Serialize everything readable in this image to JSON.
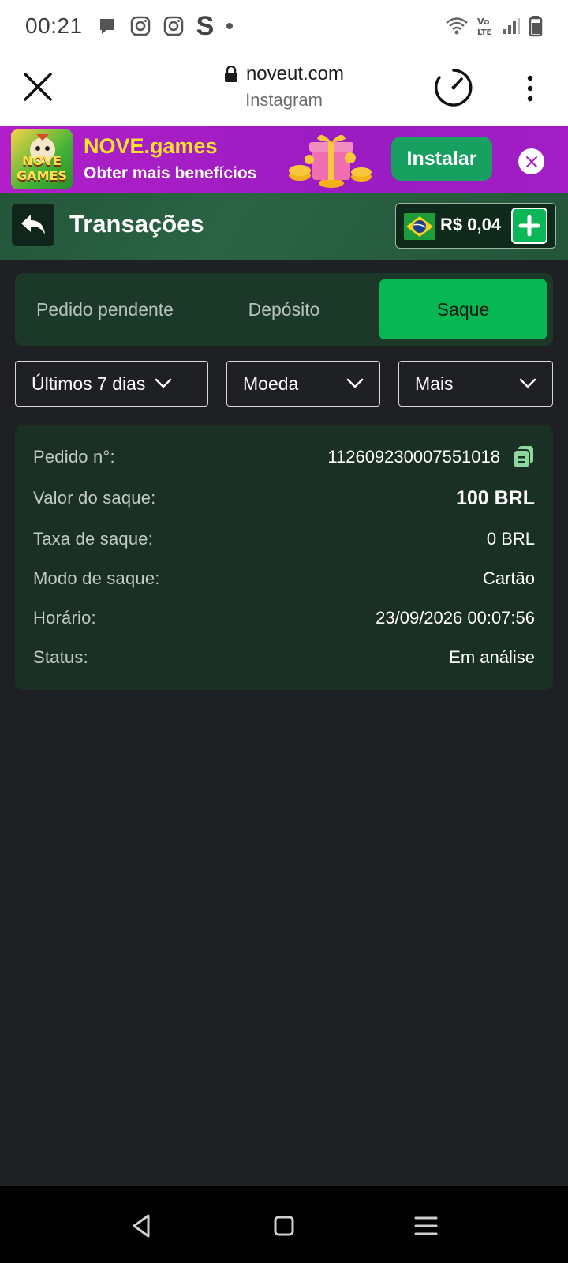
{
  "status_bar": {
    "time": "00:21",
    "icons_left": [
      "message-icon",
      "instagram-icon",
      "instagram-icon",
      "s-letter-icon"
    ],
    "s_letter": "S",
    "icons_right": [
      "wifi-icon",
      "volte-icon",
      "signal-icon",
      "battery-icon"
    ]
  },
  "browser": {
    "url": "noveut.com",
    "subtitle": "Instagram"
  },
  "banner": {
    "app_logo_text": "NOVE GAMES",
    "title": "NOVE.games",
    "subtitle": "Obter mais benefícios",
    "install_label": "Instalar"
  },
  "header": {
    "title": "Transações",
    "balance": "R$ 0,04"
  },
  "tabs": {
    "pending": "Pedido pendente",
    "deposit": "Depósito",
    "withdraw": "Saque"
  },
  "filters": {
    "period": "Últimos 7 dias",
    "currency": "Moeda",
    "more": "Mais"
  },
  "transaction": {
    "order_label": "Pedido n°:",
    "order_value": "112609230007551018",
    "amount_label": "Valor do saque:",
    "amount_value": "100 BRL",
    "fee_label": "Taxa de saque:",
    "fee_value": "0 BRL",
    "mode_label": "Modo de saque:",
    "mode_value": "Cartão",
    "time_label": "Horário:",
    "time_value": "23/09/2026 00:07:56",
    "status_label": "Status:",
    "status_value": "Em análise"
  },
  "colors": {
    "accent_green": "#06b754",
    "banner_purple": "#b21ec9",
    "banner_yellow": "#ffe22c",
    "card_bg": "#1a3024",
    "page_bg": "#1f2024"
  }
}
